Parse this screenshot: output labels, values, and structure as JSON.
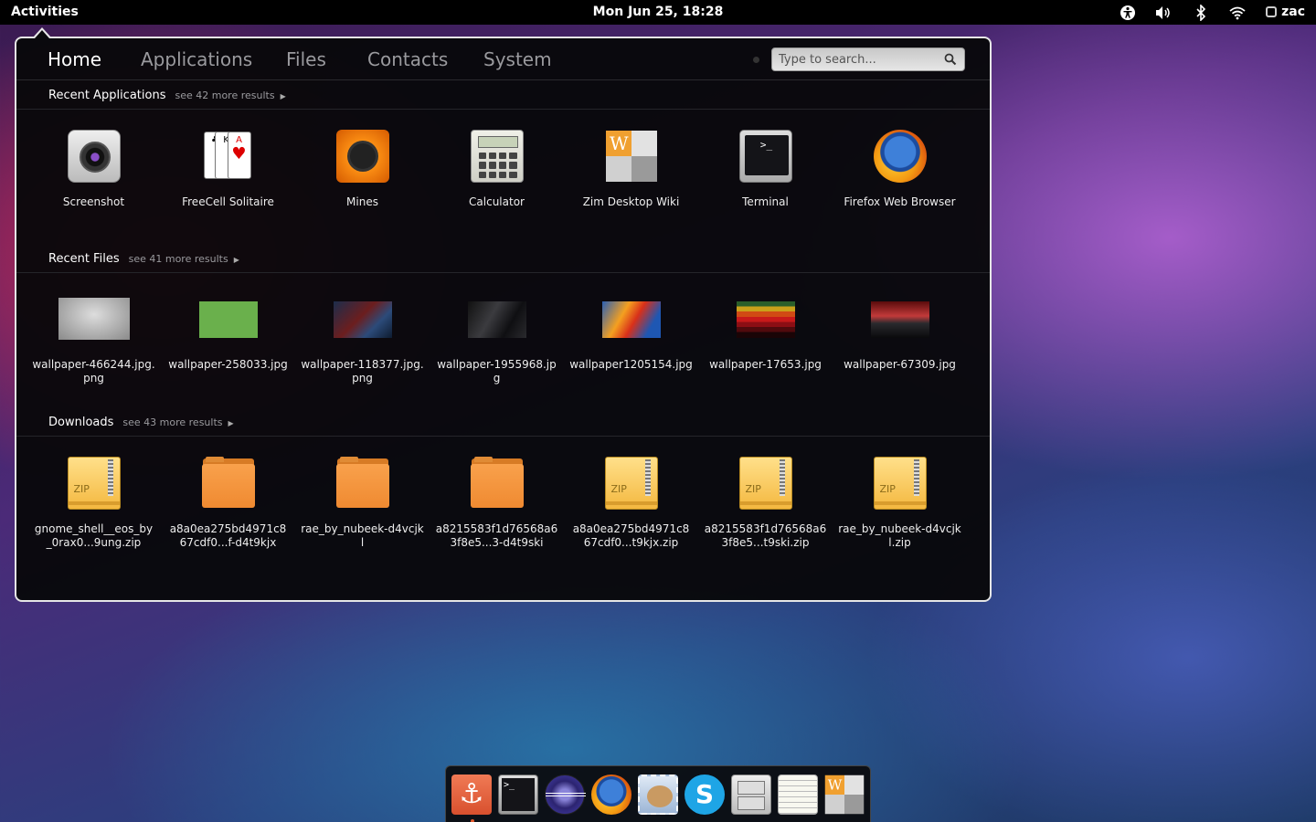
{
  "topbar": {
    "activities": "Activities",
    "clock": "Mon Jun 25, 18:28",
    "user": "zac",
    "tray_icons": [
      "accessibility-icon",
      "volume-icon",
      "bluetooth-icon",
      "wifi-icon"
    ]
  },
  "tabs": [
    "Home",
    "Applications",
    "Files",
    "Contacts",
    "System"
  ],
  "active_tab": "Home",
  "search": {
    "placeholder": "Type to search..."
  },
  "sections": {
    "recent_apps": {
      "title": "Recent Applications",
      "more": "see 42 more results",
      "items": [
        {
          "label": "Screenshot",
          "icon": "camera-icon"
        },
        {
          "label": "FreeCell Solitaire",
          "icon": "cards-icon"
        },
        {
          "label": "Mines",
          "icon": "mine-icon"
        },
        {
          "label": "Calculator",
          "icon": "calculator-icon"
        },
        {
          "label": "Zim Desktop Wiki",
          "icon": "zim-icon"
        },
        {
          "label": "Terminal",
          "icon": "terminal-icon"
        },
        {
          "label": "Firefox Web Browser",
          "icon": "firefox-icon"
        }
      ]
    },
    "recent_files": {
      "title": "Recent Files",
      "more": "see 41 more results",
      "items": [
        {
          "label": "wallpaper-466244.jpg.png"
        },
        {
          "label": "wallpaper-258033.jpg"
        },
        {
          "label": "wallpaper-118377.jpg.png"
        },
        {
          "label": "wallpaper-1955968.jpg"
        },
        {
          "label": "wallpaper1205154.jpg"
        },
        {
          "label": "wallpaper-17653.jpg"
        },
        {
          "label": "wallpaper-67309.jpg"
        }
      ]
    },
    "downloads": {
      "title": "Downloads",
      "more": "see 43 more results",
      "items": [
        {
          "label": "gnome_shell__eos_by_0rax0...9ung.zip",
          "icon": "zip-icon"
        },
        {
          "label": "a8a0ea275bd4971c867cdf0...f-d4t9kjx",
          "icon": "folder-icon"
        },
        {
          "label": "rae_by_nubeek-d4vcjkl",
          "icon": "folder-icon"
        },
        {
          "label": "a8215583f1d76568a63f8e5...3-d4t9ski",
          "icon": "folder-icon"
        },
        {
          "label": "a8a0ea275bd4971c867cdf0...t9kjx.zip",
          "icon": "zip-icon"
        },
        {
          "label": "a8215583f1d76568a63f8e5...t9ski.zip",
          "icon": "zip-icon"
        },
        {
          "label": "rae_by_nubeek-d4vcjkl.zip",
          "icon": "zip-icon"
        }
      ]
    }
  },
  "zip_text": "ZIP",
  "terminal_prompt": ">_",
  "dock": {
    "items": [
      "anchor-icon",
      "terminal-icon",
      "eclipse-icon",
      "firefox-icon",
      "mail-icon",
      "skype-icon",
      "file-cabinet-icon",
      "text-editor-icon",
      "zim-icon"
    ],
    "skype_letter": "S",
    "anchor_glyph": "⚓"
  }
}
